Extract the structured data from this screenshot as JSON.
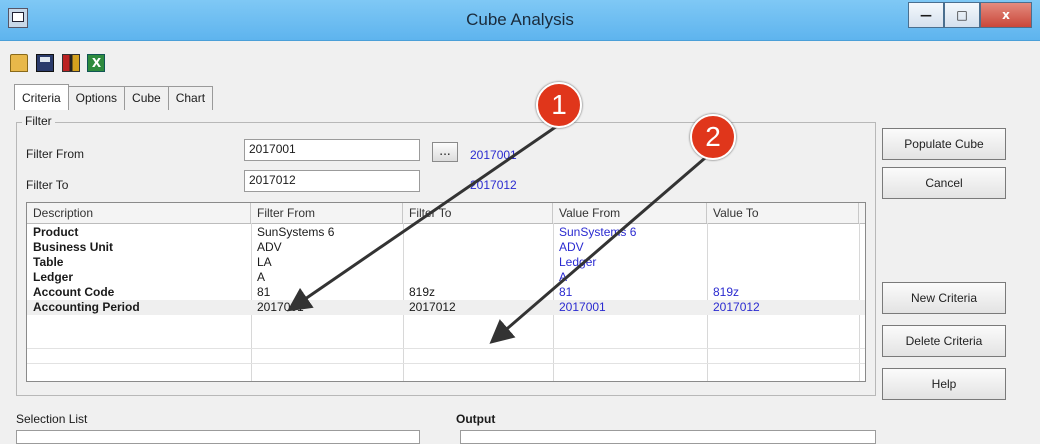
{
  "window": {
    "title": "Cube Analysis",
    "controls": [
      "—",
      "□",
      "x"
    ]
  },
  "toolbar": {
    "icons": [
      "open-folder-icon",
      "save-disk-icon",
      "books-icon",
      "excel-icon"
    ],
    "excel_glyph": "X"
  },
  "tabs": [
    "Criteria",
    "Options",
    "Cube",
    "Chart"
  ],
  "filter": {
    "group_label": "Filter",
    "from_label": "Filter From",
    "from_value": "2017001",
    "from_echo": "2017001",
    "to_label": "Filter To",
    "to_value": "2017012",
    "to_echo": "2017012",
    "browse_label": "..."
  },
  "grid": {
    "columns": [
      "Description",
      "Filter From",
      "Filter To",
      "Value From",
      "Value To"
    ],
    "rows": [
      {
        "description": "Product",
        "filter_from": "SunSystems 6",
        "filter_to": "",
        "value_from": "SunSystems 6",
        "value_to": ""
      },
      {
        "description": "Business Unit",
        "filter_from": "ADV",
        "filter_to": "",
        "value_from": "ADV",
        "value_to": ""
      },
      {
        "description": "Table",
        "filter_from": "LA",
        "filter_to": "",
        "value_from": "Ledger",
        "value_to": ""
      },
      {
        "description": "Ledger",
        "filter_from": "A",
        "filter_to": "",
        "value_from": "A",
        "value_to": ""
      },
      {
        "description": "Account Code",
        "filter_from": "81",
        "filter_to": "819z",
        "value_from": "81",
        "value_to": "819z"
      },
      {
        "description": "Accounting Period",
        "filter_from": "2017001",
        "filter_to": "2017012",
        "value_from": "2017001",
        "value_to": "2017012"
      }
    ]
  },
  "buttons": {
    "populate": "Populate Cube",
    "cancel": "Cancel",
    "new_criteria": "New Criteria",
    "delete_criteria": "Delete Criteria",
    "help": "Help"
  },
  "bottom": {
    "selection_list_label": "Selection List",
    "output_label": "Output"
  },
  "callouts": [
    "1",
    "2"
  ],
  "colors": {
    "titlebar": "#6ebef1",
    "value_text": "#2a2ad0",
    "callout": "#e0361b",
    "arrow": "#333333"
  }
}
